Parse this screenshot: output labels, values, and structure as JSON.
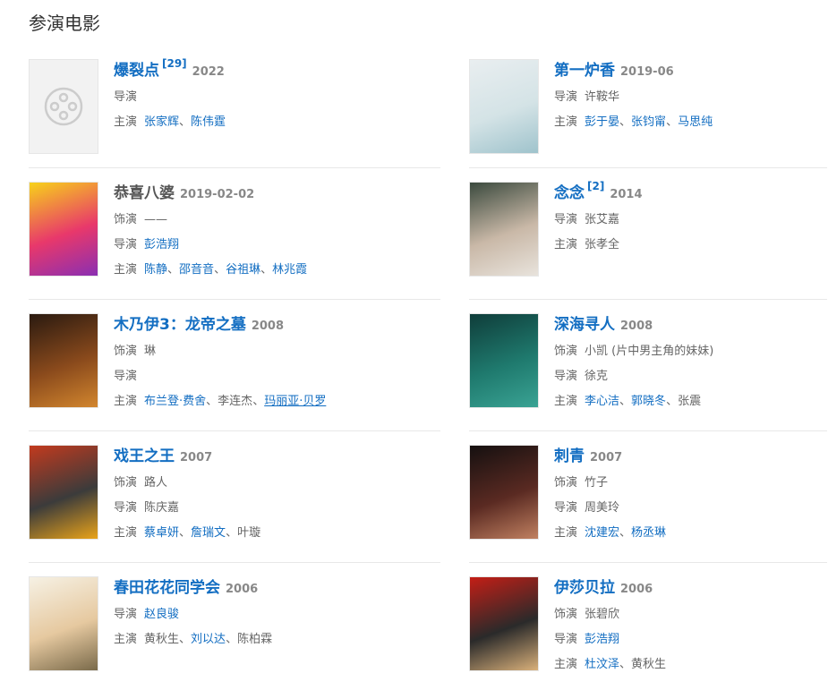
{
  "section_title": "参演电影",
  "sep": "、",
  "films": [
    {
      "title": "爆裂点",
      "ref": "[29]",
      "year": "2022",
      "title_dark": false,
      "poster": "placeholder",
      "poster_colors": [
        "#f2f2f2",
        "#f2f2f2",
        "#cccccc"
      ],
      "rows": [
        {
          "label": "导演",
          "people": []
        },
        {
          "label": "主演",
          "people": [
            {
              "name": "张家辉",
              "link": true
            },
            {
              "name": "陈伟霆",
              "link": true
            }
          ]
        }
      ]
    },
    {
      "title": "第一炉香",
      "ref": "",
      "year": "2019-06",
      "title_dark": false,
      "poster": "gradient",
      "poster_colors": [
        "#e9eef0",
        "#d4e3e6",
        "#9fc3cc"
      ],
      "rows": [
        {
          "label": "导演",
          "people": [
            {
              "name": "许鞍华",
              "link": false
            }
          ]
        },
        {
          "label": "主演",
          "people": [
            {
              "name": "彭于晏",
              "link": true
            },
            {
              "name": "张钧甯",
              "link": true
            },
            {
              "name": "马思纯",
              "link": true
            }
          ]
        }
      ]
    },
    {
      "title": "恭喜八婆",
      "ref": "",
      "year": "2019-02-02",
      "title_dark": true,
      "poster": "gradient",
      "poster_colors": [
        "#f7d21a",
        "#e8386b",
        "#8a2fb2"
      ],
      "rows": [
        {
          "label": "饰演",
          "people": [
            {
              "name": "——",
              "link": false
            }
          ]
        },
        {
          "label": "导演",
          "people": [
            {
              "name": "彭浩翔",
              "link": true
            }
          ]
        },
        {
          "label": "主演",
          "people": [
            {
              "name": "陈静",
              "link": true
            },
            {
              "name": "邵音音",
              "link": true
            },
            {
              "name": "谷祖琳",
              "link": true
            },
            {
              "name": "林兆霞",
              "link": true
            }
          ]
        }
      ]
    },
    {
      "title": "念念",
      "ref": "[2]",
      "year": "2014",
      "title_dark": false,
      "poster": "gradient",
      "poster_colors": [
        "#3b4a3e",
        "#c9b8a7",
        "#e8e3dc"
      ],
      "rows": [
        {
          "label": "导演",
          "people": [
            {
              "name": "张艾嘉",
              "link": false
            }
          ]
        },
        {
          "label": "主演",
          "people": [
            {
              "name": "张孝全",
              "link": false
            }
          ]
        }
      ]
    },
    {
      "title": "木乃伊3：龙帝之墓",
      "ref": "",
      "year": "2008",
      "title_dark": false,
      "poster": "gradient",
      "poster_colors": [
        "#2a1a10",
        "#8a4a1c",
        "#d2862e"
      ],
      "rows": [
        {
          "label": "饰演",
          "people": [
            {
              "name": "琳",
              "link": false
            }
          ]
        },
        {
          "label": "导演",
          "people": []
        },
        {
          "label": "主演",
          "people": [
            {
              "name": "布兰登·费舍",
              "link": true
            },
            {
              "name": "李连杰",
              "link": false
            },
            {
              "name": "玛丽亚·贝罗",
              "link": true,
              "under": true
            }
          ]
        }
      ]
    },
    {
      "title": "深海寻人",
      "ref": "",
      "year": "2008",
      "title_dark": false,
      "poster": "gradient",
      "poster_colors": [
        "#0f3d3a",
        "#1f7a6e",
        "#3aa394"
      ],
      "rows": [
        {
          "label": "饰演",
          "people": [
            {
              "name": "小凯 (片中男主角的妹妹)",
              "link": false
            }
          ]
        },
        {
          "label": "导演",
          "people": [
            {
              "name": "徐克",
              "link": false
            }
          ]
        },
        {
          "label": "主演",
          "people": [
            {
              "name": "李心洁",
              "link": true
            },
            {
              "name": "郭晓冬",
              "link": true
            },
            {
              "name": "张震",
              "link": false
            }
          ]
        }
      ]
    },
    {
      "title": "戏王之王",
      "ref": "",
      "year": "2007",
      "title_dark": false,
      "poster": "gradient",
      "poster_colors": [
        "#c23a1e",
        "#3b3b3b",
        "#e9a31a"
      ],
      "rows": [
        {
          "label": "饰演",
          "people": [
            {
              "name": "路人",
              "link": false
            }
          ]
        },
        {
          "label": "导演",
          "people": [
            {
              "name": "陈庆嘉",
              "link": false
            }
          ]
        },
        {
          "label": "主演",
          "people": [
            {
              "name": "蔡卓妍",
              "link": true
            },
            {
              "name": "詹瑞文",
              "link": true
            },
            {
              "name": "叶璇",
              "link": false
            }
          ]
        }
      ]
    },
    {
      "title": "刺青",
      "ref": "",
      "year": "2007",
      "title_dark": false,
      "poster": "gradient",
      "poster_colors": [
        "#151010",
        "#5a2a22",
        "#c08060"
      ],
      "rows": [
        {
          "label": "饰演",
          "people": [
            {
              "name": "竹子",
              "link": false
            }
          ]
        },
        {
          "label": "导演",
          "people": [
            {
              "name": "周美玲",
              "link": false
            }
          ]
        },
        {
          "label": "主演",
          "people": [
            {
              "name": "沈建宏",
              "link": true
            },
            {
              "name": "杨丞琳",
              "link": true
            }
          ]
        }
      ]
    },
    {
      "title": "春田花花同学会",
      "ref": "",
      "year": "2006",
      "title_dark": false,
      "poster": "gradient",
      "poster_colors": [
        "#f6f1e4",
        "#e6c9a0",
        "#7a6a4a"
      ],
      "rows": [
        {
          "label": "导演",
          "people": [
            {
              "name": "赵良骏",
              "link": true
            }
          ]
        },
        {
          "label": "主演",
          "people": [
            {
              "name": "黄秋生",
              "link": false
            },
            {
              "name": "刘以达",
              "link": true
            },
            {
              "name": "陈柏霖",
              "link": false
            }
          ]
        }
      ]
    },
    {
      "title": "伊莎贝拉",
      "ref": "",
      "year": "2006",
      "title_dark": false,
      "poster": "gradient",
      "poster_colors": [
        "#c41e16",
        "#2a2a2a",
        "#d9b07a"
      ],
      "rows": [
        {
          "label": "饰演",
          "people": [
            {
              "name": "张碧欣",
              "link": false
            }
          ]
        },
        {
          "label": "导演",
          "people": [
            {
              "name": "彭浩翔",
              "link": true
            }
          ]
        },
        {
          "label": "主演",
          "people": [
            {
              "name": "杜汶泽",
              "link": true
            },
            {
              "name": "黄秋生",
              "link": false
            }
          ]
        }
      ]
    }
  ]
}
